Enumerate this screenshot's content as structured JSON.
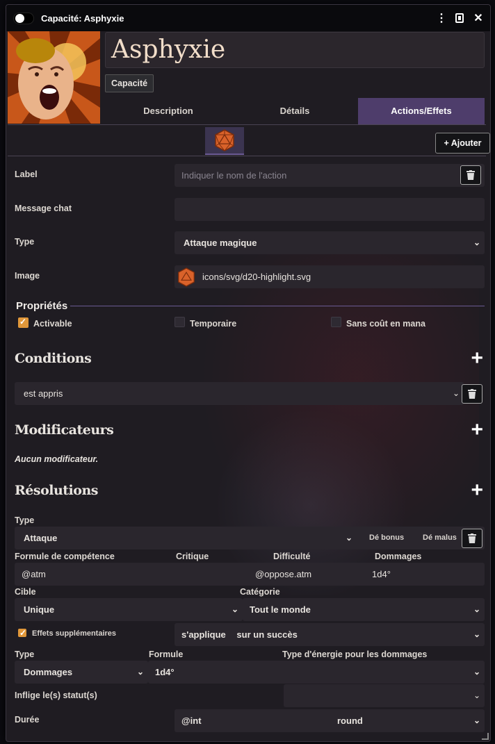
{
  "window": {
    "title": "Capacité: Asphyxie"
  },
  "item": {
    "name": "Asphyxie",
    "type_label": "Capacité"
  },
  "tabs": [
    {
      "label": "Description",
      "active": false
    },
    {
      "label": "Détails",
      "active": false
    },
    {
      "label": "Actions/Effets",
      "active": true
    }
  ],
  "toolbar": {
    "add_label": "+ Ajouter"
  },
  "action": {
    "label_label": "Label",
    "label_placeholder": "Indiquer le nom de l'action",
    "chat_label": "Message chat",
    "chat_value": "",
    "type_label": "Type",
    "type_value": "Attaque magique",
    "image_label": "Image",
    "image_value": "icons/svg/d20-highlight.svg"
  },
  "properties": {
    "title": "Propriétés",
    "activable": {
      "label": "Activable",
      "checked": true
    },
    "temporaire": {
      "label": "Temporaire",
      "checked": false
    },
    "sans_cout": {
      "label": "Sans coût en mana",
      "checked": false
    }
  },
  "conditions": {
    "title": "Conditions",
    "value": "est appris"
  },
  "modificateurs": {
    "title": "Modificateurs",
    "empty_text": "Aucun modificateur."
  },
  "resolutions": {
    "title": "Résolutions",
    "type_label": "Type",
    "type_value": "Attaque",
    "de_bonus": "Dé bonus",
    "de_malus": "Dé malus",
    "formule_label": "Formule de compétence",
    "critique_label": "Critique",
    "difficulte_label": "Difficulté",
    "dommages_label": "Dommages",
    "formule_value": "@atm",
    "critique_value": "",
    "difficulte_value": "@oppose.atm",
    "dommages_value": "1d4°",
    "cible_label": "Cible",
    "categorie_label": "Catégorie",
    "cible_value": "Unique",
    "categorie_value": "Tout le monde",
    "effets_label": "Effets supplémentaires",
    "effets_checked": true,
    "applique_label": "s'applique",
    "applique_value": "sur un succès",
    "effet_type_label": "Type",
    "effet_formule_label": "Formule",
    "energie_label": "Type d'énergie pour les dommages",
    "effet_type_value": "Dommages",
    "effet_formule_value": "1d4°",
    "energie_value": "",
    "statut_label": "Inflige le(s) statut(s)",
    "statut_value": "",
    "duree_label": "Durée",
    "duree_value": "@int",
    "duree_unit": "round"
  },
  "colors": {
    "accent": "#4e3d6b",
    "checkbox": "#e0973a",
    "dice": "#e0703a"
  }
}
